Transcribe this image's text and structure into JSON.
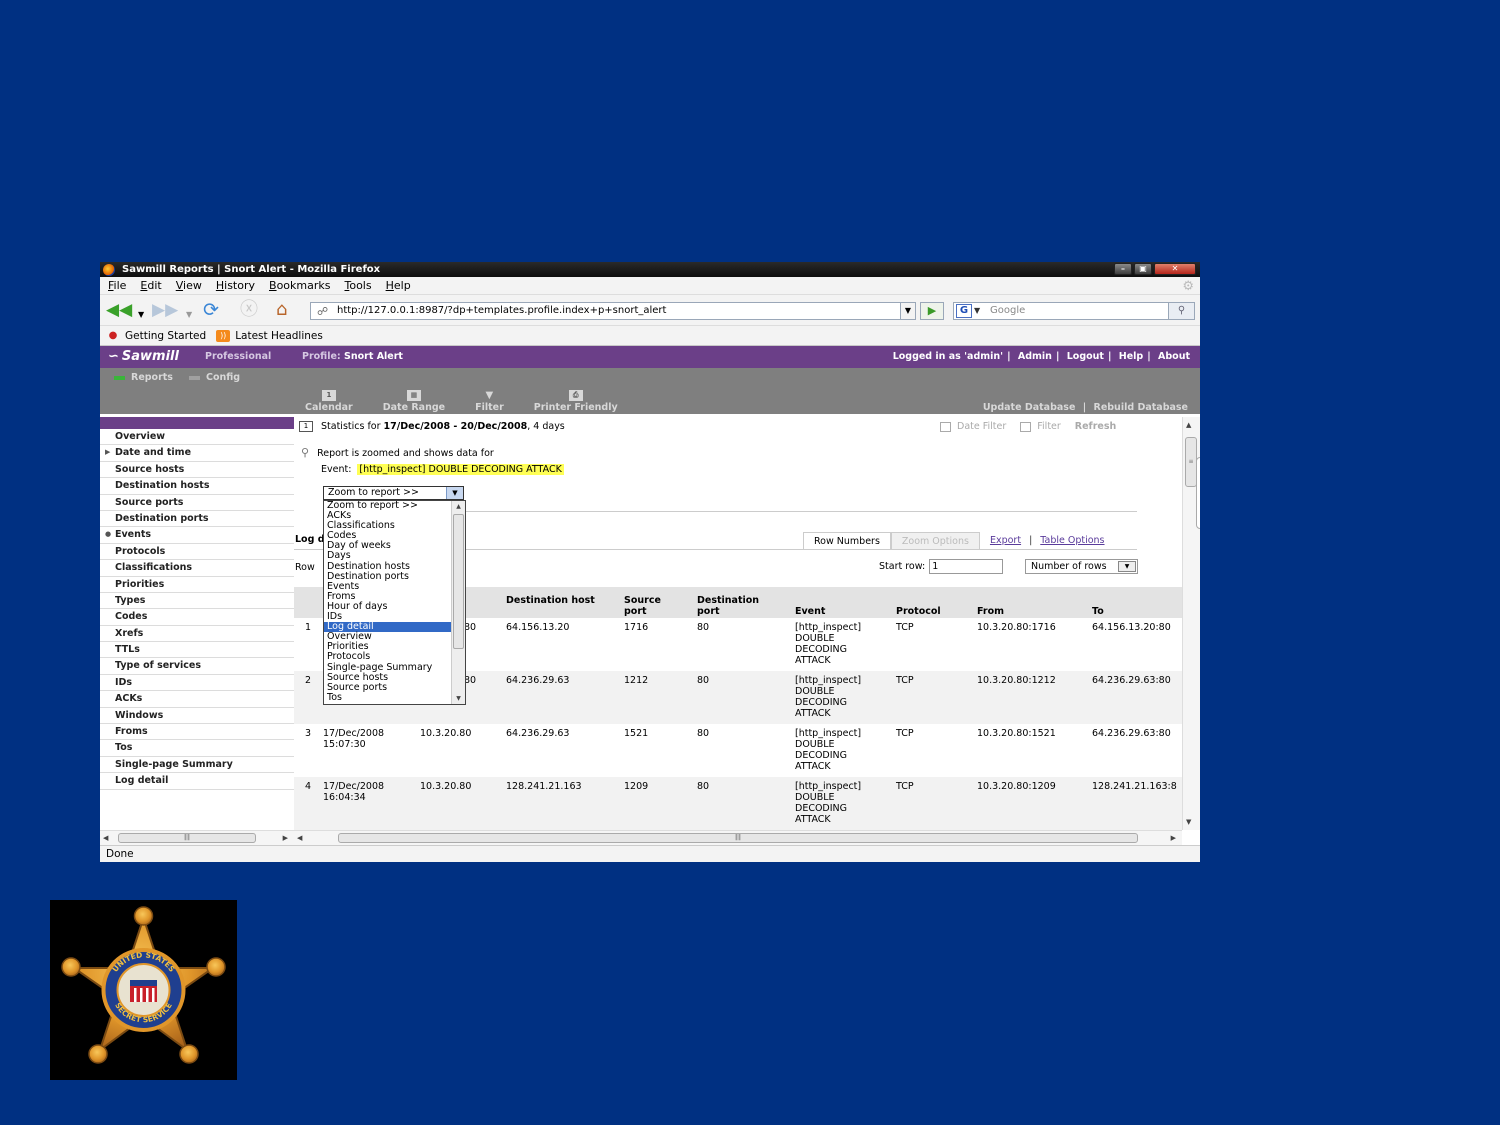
{
  "window": {
    "title": "Sawmill Reports | Snort Alert - Mozilla Firefox",
    "buttons": [
      "–",
      "▣",
      "✕"
    ]
  },
  "menu": [
    "File",
    "Edit",
    "View",
    "History",
    "Bookmarks",
    "Tools",
    "Help"
  ],
  "nav": {
    "url": "http://127.0.0.1:8987/?dp+templates.profile.index+p+snort_alert",
    "search_placeholder": "Google",
    "search_engine_letter": "G"
  },
  "bookmarks": [
    "Getting Started",
    "Latest Headlines"
  ],
  "sawmill": {
    "logo": "Sawmill",
    "edition": "Professional",
    "profile_label": "Profile:",
    "profile_name": "Snort Alert",
    "user_info": "Logged in as 'admin'",
    "right_links": [
      "Admin",
      "Logout",
      "Help",
      "About"
    ],
    "tabs": [
      {
        "label": "Reports",
        "color": "#3ab53a"
      },
      {
        "label": "Config",
        "color": "#a0a0a0"
      }
    ],
    "tools": [
      "Calendar",
      "Date Range",
      "Filter",
      "Printer Friendly"
    ],
    "db_actions": [
      "Update Database",
      "Rebuild Database"
    ]
  },
  "sidebar": {
    "items": [
      {
        "label": "Overview",
        "mark": ""
      },
      {
        "label": "Date and time",
        "mark": "▶"
      },
      {
        "label": "Source hosts",
        "mark": ""
      },
      {
        "label": "Destination hosts",
        "mark": ""
      },
      {
        "label": "Source ports",
        "mark": ""
      },
      {
        "label": "Destination ports",
        "mark": ""
      },
      {
        "label": "Events",
        "mark": "●"
      },
      {
        "label": "Protocols",
        "mark": ""
      },
      {
        "label": "Classifications",
        "mark": ""
      },
      {
        "label": "Priorities",
        "mark": ""
      },
      {
        "label": "Types",
        "mark": ""
      },
      {
        "label": "Codes",
        "mark": ""
      },
      {
        "label": "Xrefs",
        "mark": ""
      },
      {
        "label": "TTLs",
        "mark": ""
      },
      {
        "label": "Type of services",
        "mark": ""
      },
      {
        "label": "IDs",
        "mark": ""
      },
      {
        "label": "ACKs",
        "mark": ""
      },
      {
        "label": "Windows",
        "mark": ""
      },
      {
        "label": "Froms",
        "mark": ""
      },
      {
        "label": "Tos",
        "mark": ""
      },
      {
        "label": "Single-page Summary",
        "mark": ""
      },
      {
        "label": "Log detail",
        "mark": ""
      }
    ]
  },
  "report": {
    "stats_prefix": "Statistics for",
    "date_range": "17/Dec/2008 - 20/Dec/2008",
    "days": ", 4 days",
    "filters": {
      "date_filter": "Date Filter",
      "filter": "Filter",
      "refresh": "Refresh"
    },
    "zoom_message": "Report is zoomed and shows data for",
    "event_label": "Event:",
    "event_value": "[http_inspect] DOUBLE DECODING ATTACK",
    "zoom_select_value": "Zoom to report >>",
    "zoom_options": [
      "Zoom to report >>",
      "ACKs",
      "Classifications",
      "Codes",
      "Day of weeks",
      "Days",
      "Destination hosts",
      "Destination ports",
      "Events",
      "Froms",
      "Hour of days",
      "IDs",
      "Log detail",
      "Overview",
      "Priorities",
      "Protocols",
      "Single-page Summary",
      "Source hosts",
      "Source ports",
      "Tos"
    ],
    "zoom_selected": "Log detail",
    "log_title": "Log d",
    "rows_label": "Row",
    "tabs": {
      "row_numbers": "Row Numbers",
      "zoom_options": "Zoom Options",
      "export": "Export",
      "table_options": "Table Options"
    },
    "start_row_label": "Start row:",
    "start_row_value": "1",
    "number_of_rows": "Number of rows"
  },
  "table": {
    "headers": [
      "Destination host",
      "Source port",
      "Destination port",
      "Event",
      "Protocol",
      "From",
      "To"
    ],
    "rows": [
      {
        "n": "1",
        "date": "",
        "time": "",
        "src": "",
        "src_tail": "80",
        "dst": "64.156.13.20",
        "sport": "1716",
        "dport": "80",
        "event": [
          "[http_inspect]",
          "DOUBLE",
          "DECODING",
          "ATTACK"
        ],
        "proto": "TCP",
        "from": "10.3.20.80:1716",
        "to": "64.156.13.20:80"
      },
      {
        "n": "2",
        "date": "",
        "time": "",
        "src": "",
        "src_tail": "80",
        "dst": "64.236.29.63",
        "sport": "1212",
        "dport": "80",
        "event": [
          "[http_inspect]",
          "DOUBLE",
          "DECODING",
          "ATTACK"
        ],
        "proto": "TCP",
        "from": "10.3.20.80:1212",
        "to": "64.236.29.63:80"
      },
      {
        "n": "3",
        "date": "17/Dec/2008",
        "time": "15:07:30",
        "src": "10.3.20.80",
        "src_tail": "",
        "dst": "64.236.29.63",
        "sport": "1521",
        "dport": "80",
        "event": [
          "[http_inspect]",
          "DOUBLE",
          "DECODING",
          "ATTACK"
        ],
        "proto": "TCP",
        "from": "10.3.20.80:1521",
        "to": "64.236.29.63:80"
      },
      {
        "n": "4",
        "date": "17/Dec/2008",
        "time": "16:04:34",
        "src": "10.3.20.80",
        "src_tail": "",
        "dst": "128.241.21.163",
        "sport": "1209",
        "dport": "80",
        "event": [
          "[http_inspect]",
          "DOUBLE",
          "DECODING",
          "ATTACK"
        ],
        "proto": "TCP",
        "from": "10.3.20.80:1209",
        "to": "128.241.21.163:8"
      }
    ]
  },
  "status": "Done",
  "badge": {
    "text_top": "UNITED STATES",
    "text_bottom": "SECRET SERVICE",
    "colors": {
      "gold": "#e0962a",
      "dark_gold": "#a8621a",
      "blue": "#1f3f8f",
      "red": "#c8202a"
    }
  }
}
